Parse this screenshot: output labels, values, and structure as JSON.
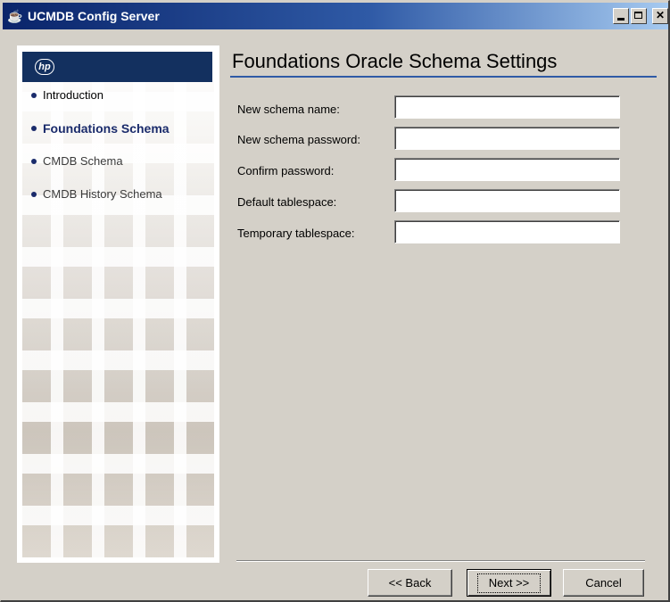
{
  "window": {
    "title": "UCMDB Config Server"
  },
  "sidebar": {
    "logo_text": "hp",
    "steps": [
      {
        "label": "Introduction",
        "state": "done"
      },
      {
        "label": "Foundations Schema",
        "state": "active"
      },
      {
        "label": "CMDB Schema",
        "state": "pending"
      },
      {
        "label": "CMDB History Schema",
        "state": "pending"
      }
    ]
  },
  "main": {
    "heading": "Foundations Oracle Schema Settings",
    "fields": [
      {
        "label": "New schema name:",
        "value": ""
      },
      {
        "label": "New schema password:",
        "value": ""
      },
      {
        "label": "Confirm password:",
        "value": ""
      },
      {
        "label": "Default tablespace:",
        "value": ""
      },
      {
        "label": "Temporary tablespace:",
        "value": ""
      }
    ]
  },
  "buttons": {
    "back": "<< Back",
    "next": "Next >>",
    "cancel": "Cancel"
  },
  "colors": {
    "accent": "#13305f",
    "titlebar_start": "#0a246a",
    "titlebar_end": "#a6caf0",
    "dialog_bg": "#d4d0c8"
  }
}
